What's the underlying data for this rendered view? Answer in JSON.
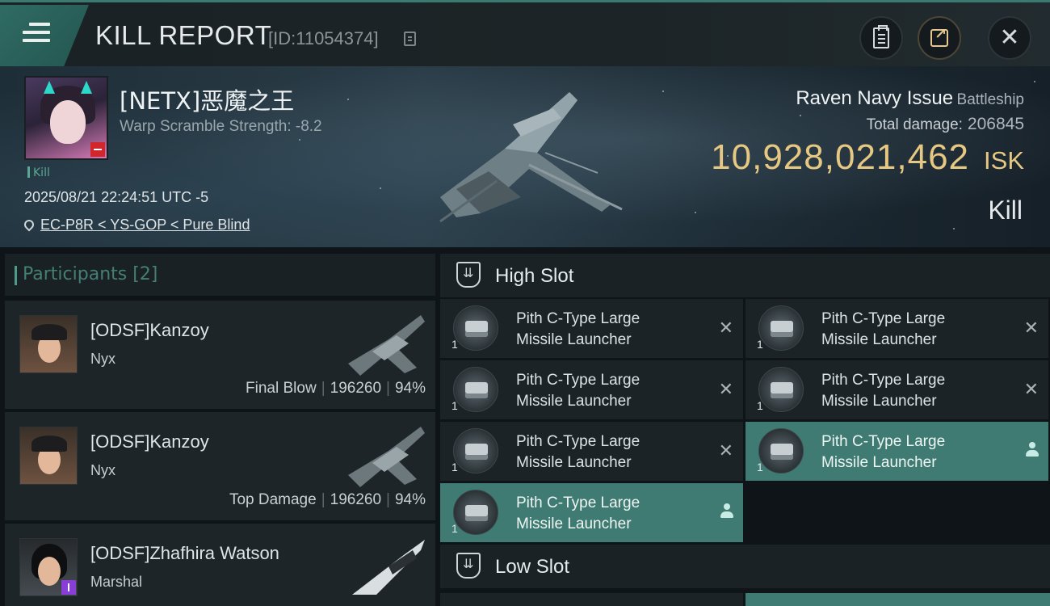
{
  "header": {
    "title": "KILL REPORT",
    "report_id": "[ID:11054374]",
    "icons": [
      "menu-icon",
      "copy-icon",
      "clipboard-icon",
      "share-icon",
      "close-icon"
    ]
  },
  "victim": {
    "name": "[NETX]恶魔之王",
    "warp_scramble": "Warp Scramble Strength: -8.2",
    "tag": "Kill",
    "datetime": "2025/08/21 22:24:51 UTC -5",
    "location": "EC-P8R < YS-GOP < Pure Blind",
    "ship_name": "Raven Navy Issue",
    "ship_class": "Battleship",
    "total_damage_label": "Total damage:",
    "total_damage": "206845",
    "isk_value": "10,928,021,462",
    "isk_unit": "ISK",
    "kill_type": "Kill"
  },
  "participants": {
    "label": "Participants [2]",
    "items": [
      {
        "name": "[ODSF]Kanzoy",
        "ship": "Nyx",
        "role": "Final Blow",
        "damage": "196260",
        "percent": "94%"
      },
      {
        "name": "[ODSF]Kanzoy",
        "ship": "Nyx",
        "role": "Top Damage",
        "damage": "196260",
        "percent": "94%"
      },
      {
        "name": "[ODSF]Zhafhira Watson",
        "ship": "Marshal"
      }
    ]
  },
  "fitting": {
    "high_slot_label": "High Slot",
    "low_slot_label": "Low Slot",
    "high_slot_modules": [
      {
        "line1": "Pith C-Type Large",
        "line2": "Missile Launcher",
        "qty": "1",
        "state": "destroyed"
      },
      {
        "line1": "Pith C-Type Large",
        "line2": "Missile Launcher",
        "qty": "1",
        "state": "destroyed"
      },
      {
        "line1": "Pith C-Type Large",
        "line2": "Missile Launcher",
        "qty": "1",
        "state": "destroyed"
      },
      {
        "line1": "Pith C-Type Large",
        "line2": "Missile Launcher",
        "qty": "1",
        "state": "destroyed"
      },
      {
        "line1": "Pith C-Type Large",
        "line2": "Missile Launcher",
        "qty": "1",
        "state": "destroyed"
      },
      {
        "line1": "Pith C-Type Large",
        "line2": "Missile Launcher",
        "qty": "1",
        "state": "dropped"
      },
      {
        "line1": "Pith C-Type Large",
        "line2": "Missile Launcher",
        "qty": "1",
        "state": "dropped"
      }
    ]
  },
  "colors": {
    "accent_teal": "#3f7b72",
    "isk_gold": "#e6c882",
    "destroyed_mark": "#a9b2b6"
  }
}
